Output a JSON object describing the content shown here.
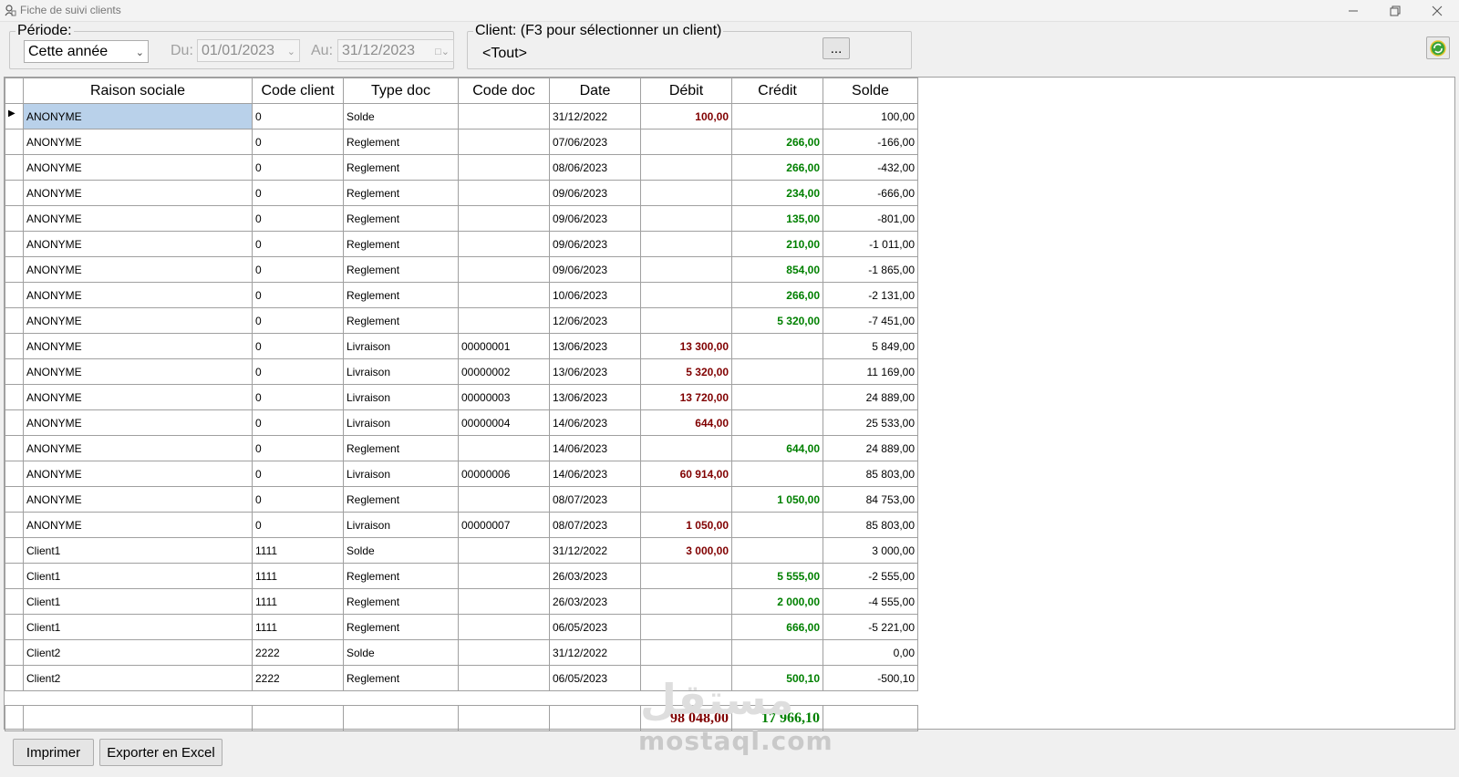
{
  "window": {
    "title": "Fiche de suivi clients"
  },
  "filters": {
    "periode_label": "Période:",
    "periode_value": "Cette année",
    "du_label": "Du:",
    "du_value": "01/01/2023",
    "au_label": "Au:",
    "au_value": "31/12/2023",
    "client_label": "Client: (F3 pour sélectionner un client)",
    "client_value": "<Tout>",
    "browse_label": "..."
  },
  "columns": [
    "Raison sociale",
    "Code client",
    "Type doc",
    "Code doc",
    "Date",
    "Débit",
    "Crédit",
    "Solde"
  ],
  "rows": [
    [
      "ANONYME",
      "0",
      "Solde",
      "",
      "31/12/2022",
      "100,00",
      "",
      "100,00"
    ],
    [
      "ANONYME",
      "0",
      "Reglement",
      "",
      "07/06/2023",
      "",
      "266,00",
      "-166,00"
    ],
    [
      "ANONYME",
      "0",
      "Reglement",
      "",
      "08/06/2023",
      "",
      "266,00",
      "-432,00"
    ],
    [
      "ANONYME",
      "0",
      "Reglement",
      "",
      "09/06/2023",
      "",
      "234,00",
      "-666,00"
    ],
    [
      "ANONYME",
      "0",
      "Reglement",
      "",
      "09/06/2023",
      "",
      "135,00",
      "-801,00"
    ],
    [
      "ANONYME",
      "0",
      "Reglement",
      "",
      "09/06/2023",
      "",
      "210,00",
      "-1 011,00"
    ],
    [
      "ANONYME",
      "0",
      "Reglement",
      "",
      "09/06/2023",
      "",
      "854,00",
      "-1 865,00"
    ],
    [
      "ANONYME",
      "0",
      "Reglement",
      "",
      "10/06/2023",
      "",
      "266,00",
      "-2 131,00"
    ],
    [
      "ANONYME",
      "0",
      "Reglement",
      "",
      "12/06/2023",
      "",
      "5 320,00",
      "-7 451,00"
    ],
    [
      "ANONYME",
      "0",
      "Livraison",
      "00000001",
      "13/06/2023",
      "13 300,00",
      "",
      "5 849,00"
    ],
    [
      "ANONYME",
      "0",
      "Livraison",
      "00000002",
      "13/06/2023",
      "5 320,00",
      "",
      "11 169,00"
    ],
    [
      "ANONYME",
      "0",
      "Livraison",
      "00000003",
      "13/06/2023",
      "13 720,00",
      "",
      "24 889,00"
    ],
    [
      "ANONYME",
      "0",
      "Livraison",
      "00000004",
      "14/06/2023",
      "644,00",
      "",
      "25 533,00"
    ],
    [
      "ANONYME",
      "0",
      "Reglement",
      "",
      "14/06/2023",
      "",
      "644,00",
      "24 889,00"
    ],
    [
      "ANONYME",
      "0",
      "Livraison",
      "00000006",
      "14/06/2023",
      "60 914,00",
      "",
      "85 803,00"
    ],
    [
      "ANONYME",
      "0",
      "Reglement",
      "",
      "08/07/2023",
      "",
      "1 050,00",
      "84 753,00"
    ],
    [
      "ANONYME",
      "0",
      "Livraison",
      "00000007",
      "08/07/2023",
      "1 050,00",
      "",
      "85 803,00"
    ],
    [
      "Client1",
      "1111",
      "Solde",
      "",
      "31/12/2022",
      "3 000,00",
      "",
      "3 000,00"
    ],
    [
      "Client1",
      "1111",
      "Reglement",
      "",
      "26/03/2023",
      "",
      "5 555,00",
      "-2 555,00"
    ],
    [
      "Client1",
      "1111",
      "Reglement",
      "",
      "26/03/2023",
      "",
      "2 000,00",
      "-4 555,00"
    ],
    [
      "Client1",
      "1111",
      "Reglement",
      "",
      "06/05/2023",
      "",
      "666,00",
      "-5 221,00"
    ],
    [
      "Client2",
      "2222",
      "Solde",
      "",
      "31/12/2022",
      "",
      "",
      "0,00"
    ],
    [
      "Client2",
      "2222",
      "Reglement",
      "",
      "06/05/2023",
      "",
      "500,10",
      "-500,10"
    ]
  ],
  "totals": {
    "debit": "98 048,00",
    "credit": "17 966,10"
  },
  "actions": {
    "print_label": "Imprimer",
    "excel_label": "Exporter en Excel"
  },
  "watermark": {
    "latin": "mostaql.com",
    "arabic": "مستقل"
  },
  "colors": {
    "debit": "#800000",
    "credit": "#008000",
    "selection": "#b9d1ea"
  }
}
